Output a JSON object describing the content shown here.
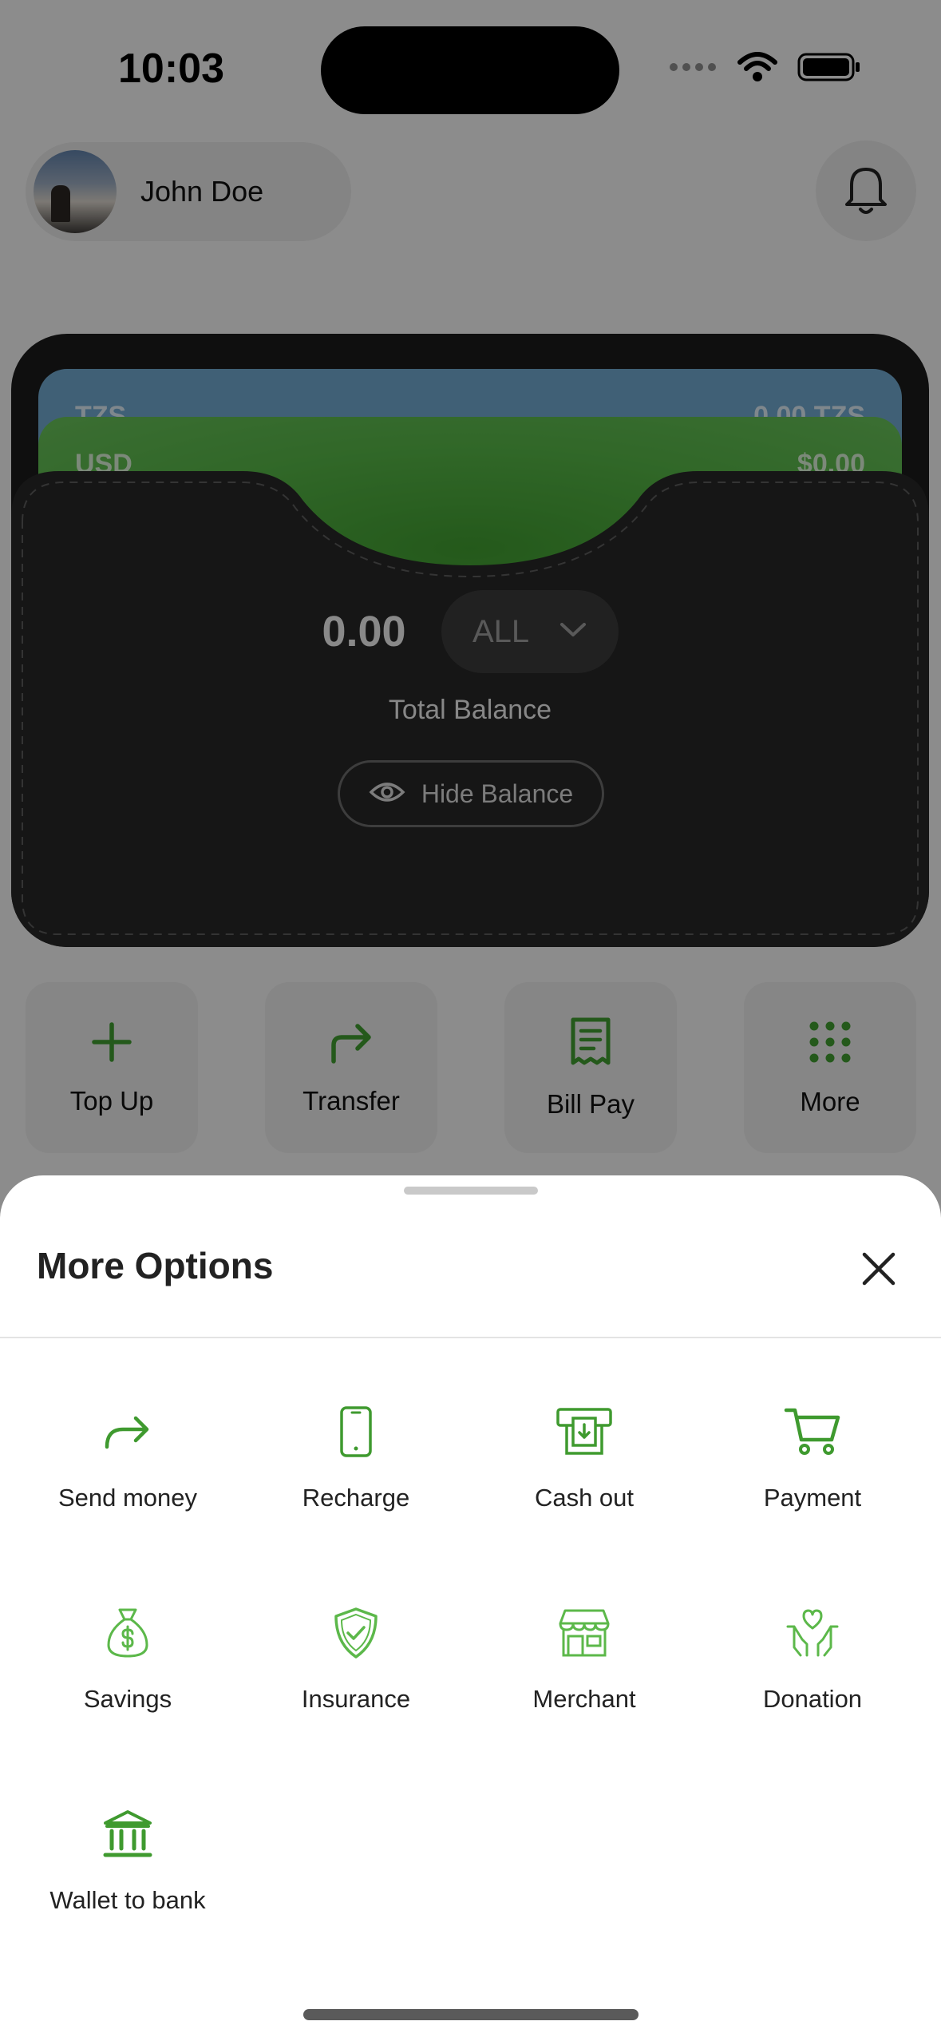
{
  "status_bar": {
    "time": "10:03"
  },
  "profile": {
    "name": "John Doe"
  },
  "wallet": {
    "cards": [
      {
        "label": "TZS",
        "amount": "0.00 TZS"
      },
      {
        "label": "USD",
        "amount": "$0.00"
      }
    ],
    "balance": "0.00",
    "currency": "ALL",
    "total_label": "Total Balance",
    "hide_balance_label": "Hide Balance"
  },
  "actions": [
    {
      "label": "Top Up",
      "icon": "plus-icon"
    },
    {
      "label": "Transfer",
      "icon": "forward-arrow-icon"
    },
    {
      "label": "Bill Pay",
      "icon": "receipt-icon"
    },
    {
      "label": "More",
      "icon": "grid-dots-icon"
    }
  ],
  "sheet": {
    "title": "More Options",
    "options": [
      {
        "label": "Send money",
        "icon": "send-arrow-icon"
      },
      {
        "label": "Recharge",
        "icon": "phone-icon"
      },
      {
        "label": "Cash out",
        "icon": "atm-icon"
      },
      {
        "label": "Payment",
        "icon": "cart-icon"
      },
      {
        "label": "Savings",
        "icon": "money-bag-icon"
      },
      {
        "label": "Insurance",
        "icon": "shield-check-icon"
      },
      {
        "label": "Merchant",
        "icon": "store-icon"
      },
      {
        "label": "Donation",
        "icon": "donation-hands-icon"
      },
      {
        "label": "Wallet to bank",
        "icon": "bank-icon"
      }
    ]
  },
  "colors": {
    "accent_green": "#3f9a2f",
    "sheet_bg": "#ffffff",
    "overlay": "rgba(0,0,0,0.42)"
  }
}
